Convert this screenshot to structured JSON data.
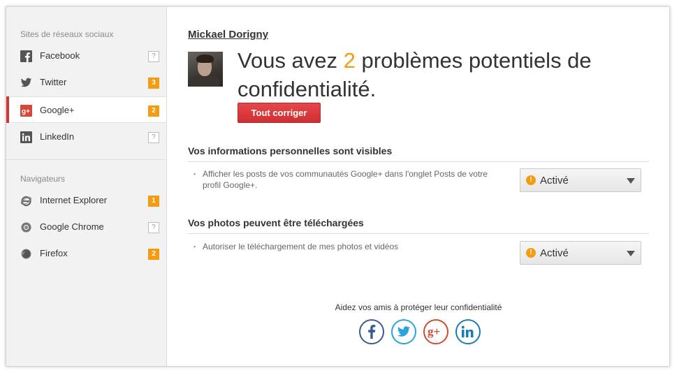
{
  "sidebar": {
    "social_title": "Sites de réseaux sociaux",
    "social_items": [
      {
        "label": "Facebook",
        "badge": "?"
      },
      {
        "label": "Twitter",
        "badge": "3"
      },
      {
        "label": "Google+",
        "badge": "2"
      },
      {
        "label": "LinkedIn",
        "badge": "?"
      }
    ],
    "browsers_title": "Navigateurs",
    "browser_items": [
      {
        "label": "Internet Explorer",
        "badge": "1"
      },
      {
        "label": "Google Chrome",
        "badge": "?"
      },
      {
        "label": "Firefox",
        "badge": "2"
      }
    ]
  },
  "main": {
    "user_name": "Mickael Dorigny",
    "headline_pre": "Vous avez ",
    "headline_count": "2",
    "headline_post": " problèmes potentiels de confidentialité.",
    "fix_button": "Tout corriger",
    "sections": [
      {
        "heading": "Vos informations personnelles sont visibles",
        "setting": "Afficher les posts de vos communautés Google+ dans l'onglet Posts de votre profil Google+.",
        "status": "Activé"
      },
      {
        "heading": "Vos photos peuvent être téléchargées",
        "setting": "Autoriser le téléchargement de mes photos et vidéos",
        "status": "Activé"
      }
    ],
    "share_text": "Aidez vos amis à protéger leur confidentialité"
  },
  "colors": {
    "accent_orange": "#f39c12",
    "accent_red": "#d63333",
    "facebook": "#3b5998",
    "twitter": "#2aa3e0",
    "googleplus": "#d34836",
    "linkedin": "#1a7bb9"
  },
  "icons": [
    "facebook-icon",
    "twitter-icon",
    "googleplus-icon",
    "linkedin-icon",
    "internet-explorer-icon",
    "chrome-icon",
    "firefox-icon",
    "warning-icon",
    "chevron-down-icon"
  ]
}
